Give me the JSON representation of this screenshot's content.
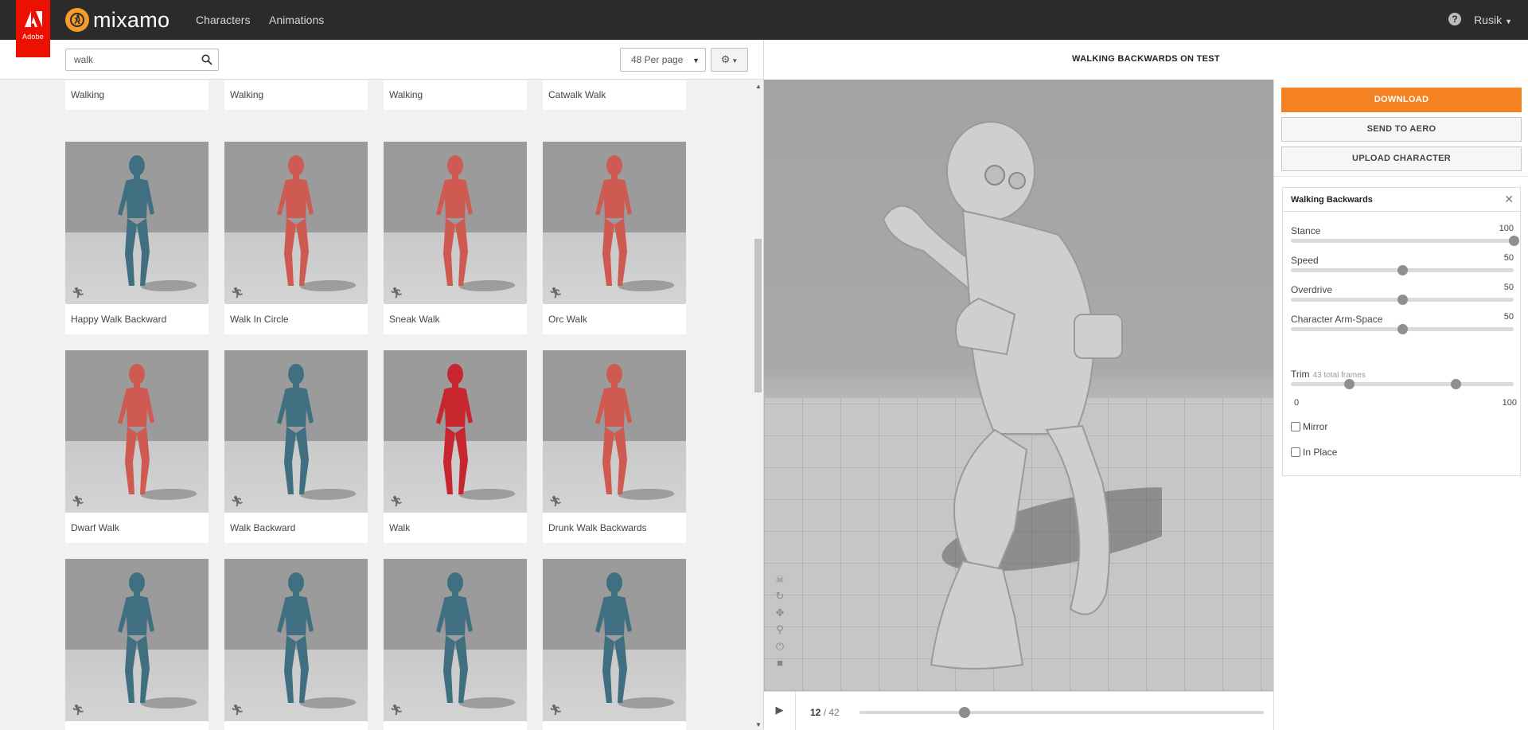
{
  "brand": {
    "adobe_label": "Adobe",
    "name": "mixamo"
  },
  "nav": {
    "characters": "Characters",
    "animations": "Animations"
  },
  "user": {
    "name": "Rusik",
    "help": "?"
  },
  "library": {
    "search_value": "walk",
    "per_page": "48 Per page",
    "cards": [
      {
        "label": "Walking",
        "color": "#3f6f80"
      },
      {
        "label": "Walking",
        "color": "#3f6f80"
      },
      {
        "label": "Walking",
        "color": "#3f6f80"
      },
      {
        "label": "Catwalk Walk",
        "color": "#cf5a52"
      },
      {
        "label": "Happy Walk Backward",
        "color": "#3f6f80"
      },
      {
        "label": "Walk In Circle",
        "color": "#cf5a52"
      },
      {
        "label": "Sneak Walk",
        "color": "#cf5a52"
      },
      {
        "label": "Orc Walk",
        "color": "#cf5a52"
      },
      {
        "label": "Dwarf Walk",
        "color": "#cf5a52"
      },
      {
        "label": "Walk Backward",
        "color": "#3f6f80"
      },
      {
        "label": "Walk",
        "color": "#c8262e"
      },
      {
        "label": "Drunk Walk Backwards",
        "color": "#cf5a52"
      },
      {
        "label": "",
        "color": "#3f6f80"
      },
      {
        "label": "",
        "color": "#3f6f80"
      },
      {
        "label": "",
        "color": "#3f6f80"
      },
      {
        "label": "",
        "color": "#3f6f80"
      }
    ]
  },
  "viewer": {
    "title": "WALKING BACKWARDS ON TEST",
    "frame_current": "12",
    "frame_total": "/ 42",
    "timeline_progress": 0.26
  },
  "sidebar": {
    "download": "DOWNLOAD",
    "send_to_aero": "SEND TO AERO",
    "upload_character": "UPLOAD CHARACTER",
    "accent": "#f58220",
    "panel_title": "Walking Backwards",
    "params": [
      {
        "name": "Stance",
        "value": "100",
        "level": 1.0
      },
      {
        "name": "Speed",
        "value": "50",
        "level": 0.5
      },
      {
        "name": "Overdrive",
        "value": "50",
        "level": 0.5
      },
      {
        "name": "Character Arm-Space",
        "value": "50",
        "level": 0.5
      }
    ],
    "trim": {
      "label": "Trim",
      "sub": "43 total frames",
      "min": "0",
      "max": "100",
      "start": 0.26,
      "end": 0.74
    },
    "mirror": "Mirror",
    "in_place": "In Place"
  }
}
